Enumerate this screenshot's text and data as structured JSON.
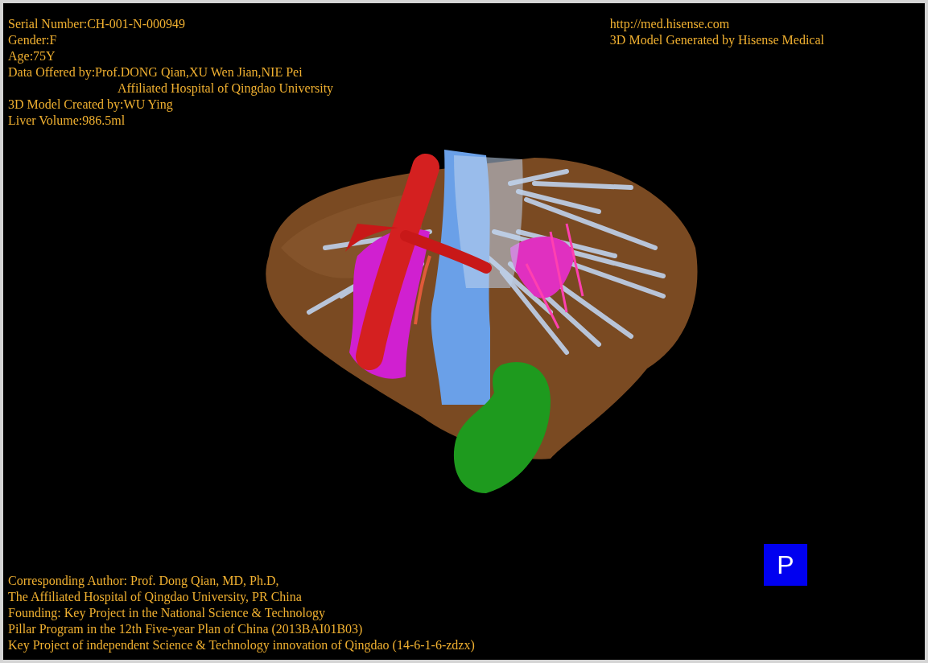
{
  "header_left": [
    {
      "text": "Serial Number:CH-001-N-000949"
    },
    {
      "text": "Gender:F"
    },
    {
      "text": "Age:75Y"
    },
    {
      "text": "Data Offered by:Prof.DONG Qian,XU Wen Jian,NIE Pei",
      "continuation": "Affiliated Hospital of Qingdao University"
    },
    {
      "text": "3D Model Created by:WU Ying"
    },
    {
      "text": "Liver Volume:986.5ml"
    }
  ],
  "header_right": [
    "http://med.hisense.com",
    "3D Model Generated by Hisense Medical"
  ],
  "footer": [
    "Corresponding Author: Prof. Dong Qian, MD, Ph.D,",
    "The Affiliated Hospital of Qingdao University, PR China",
    "Founding: Key Project in the National Science & Technology",
    "Pillar Program in the 12th Five-year Plan of China (2013BAI01B03)",
    "Key Project of independent Science & Technology innovation of Qingdao (14-6-1-6-zdzx)"
  ],
  "view_badge": "P"
}
